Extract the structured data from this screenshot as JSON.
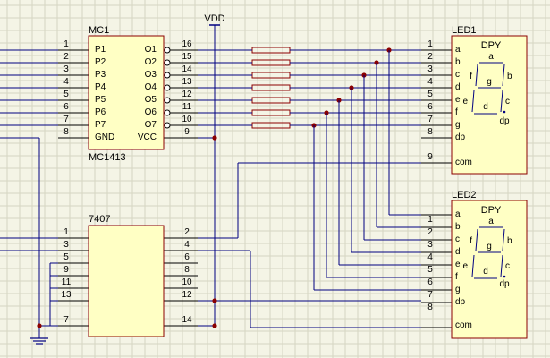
{
  "mc1": {
    "ref": "MC1",
    "part": "MC1413",
    "left_pin_numbers": [
      "1",
      "2",
      "3",
      "4",
      "5",
      "6",
      "7",
      "8"
    ],
    "left_pin_names": [
      "P1",
      "P2",
      "P3",
      "P4",
      "P5",
      "P6",
      "P7",
      "GND"
    ],
    "right_pin_names": [
      "O1",
      "O2",
      "O3",
      "O4",
      "O5",
      "O6",
      "O7",
      "VCC"
    ],
    "right_pin_numbers": [
      "16",
      "15",
      "14",
      "13",
      "12",
      "11",
      "10",
      "9"
    ]
  },
  "vdd": {
    "label": "VDD"
  },
  "ic7407": {
    "part": "7407",
    "left_pin_numbers": [
      "1",
      "3",
      "5",
      "9",
      "11",
      "13",
      "7"
    ],
    "right_pin_numbers": [
      "2",
      "4",
      "6",
      "8",
      "10",
      "12",
      "14"
    ]
  },
  "led1": {
    "ref": "LED1",
    "type": "DPY",
    "pin_numbers": [
      "1",
      "2",
      "3",
      "4",
      "5",
      "6",
      "7",
      "8",
      "9"
    ],
    "pin_names": [
      "a",
      "b",
      "c",
      "d",
      "e",
      "f",
      "g",
      "dp",
      "com"
    ],
    "segment_labels": [
      "a",
      "b",
      "c",
      "d",
      "e",
      "f",
      "g",
      "dp"
    ]
  },
  "led2": {
    "ref": "LED2",
    "type": "DPY",
    "pin_numbers": [
      "1",
      "2",
      "3",
      "4",
      "5",
      "6",
      "7",
      "8"
    ],
    "pin_names": [
      "a",
      "b",
      "c",
      "d",
      "e",
      "f",
      "g",
      "dp",
      "com"
    ],
    "segment_labels": [
      "a",
      "b",
      "c",
      "d",
      "e",
      "f",
      "g",
      "dp"
    ]
  },
  "colors": {
    "background": "#f4f4e6",
    "grid": "#d5d5c2",
    "wire": "#000080",
    "component_fill": "#ffffc4",
    "component_border": "#8b0000",
    "pin_line": "#000000"
  }
}
